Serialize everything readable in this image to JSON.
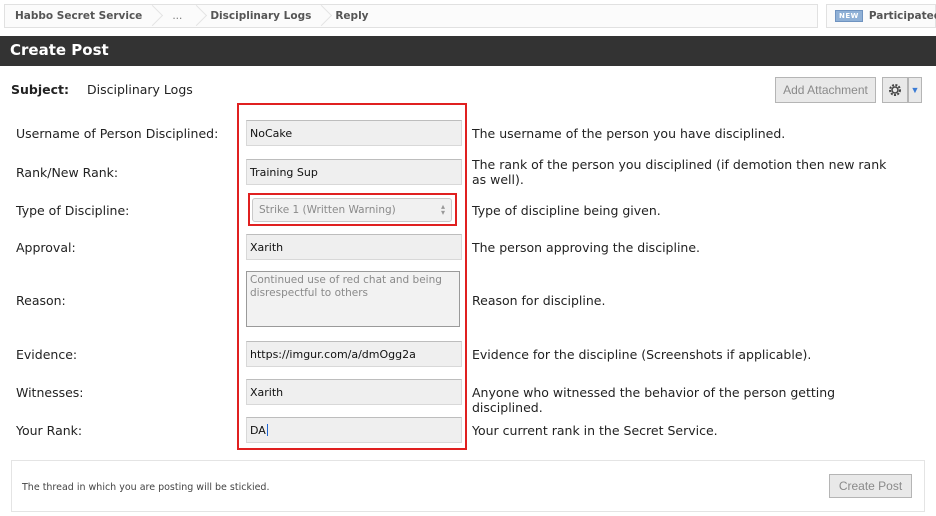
{
  "breadcrumb": [
    "Habbo Secret Service",
    "...",
    "Disciplinary Logs",
    "Reply"
  ],
  "participated": {
    "badge": "NEW",
    "label": "Participated"
  },
  "header": {
    "title": "Create Post"
  },
  "subject": {
    "label": "Subject:",
    "value": "Disciplinary Logs"
  },
  "toolbar": {
    "add_attachment": "Add Attachment",
    "gear_icon": "gear-icon",
    "dropdown_icon": "chevron-down-icon"
  },
  "fields": [
    {
      "label": "Username of Person Disciplined:",
      "value": "NoCake",
      "desc": "The username of the person you have disciplined."
    },
    {
      "label": "Rank/New Rank:",
      "value": "Training Sup",
      "desc": "The rank of the person you disciplined (if demotion then new rank as well)."
    },
    {
      "label": "Type of Discipline:",
      "value": "Strike 1 (Written Warning)",
      "desc": "Type of discipline being given."
    },
    {
      "label": "Approval:",
      "value": "Xarith",
      "desc": "The person approving the discipline."
    },
    {
      "label": "Reason:",
      "value": "Continued use of red chat and being disrespectful to others",
      "desc": "Reason for discipline."
    },
    {
      "label": "Evidence:",
      "value": "https://imgur.com/a/dmOgg2a",
      "desc": "Evidence for the discipline (Screenshots if applicable)."
    },
    {
      "label": "Witnesses:",
      "value": "Xarith",
      "desc": "Anyone who witnessed the behavior of the person getting disciplined."
    },
    {
      "label": "Your Rank:",
      "value": "DA",
      "desc": "Your current rank in the Secret Service."
    }
  ],
  "footer": {
    "text": "The thread in which you are posting will be stickied.",
    "button": "Create Post"
  },
  "colors": {
    "header_bg": "#333333",
    "highlight": "#e02020"
  }
}
